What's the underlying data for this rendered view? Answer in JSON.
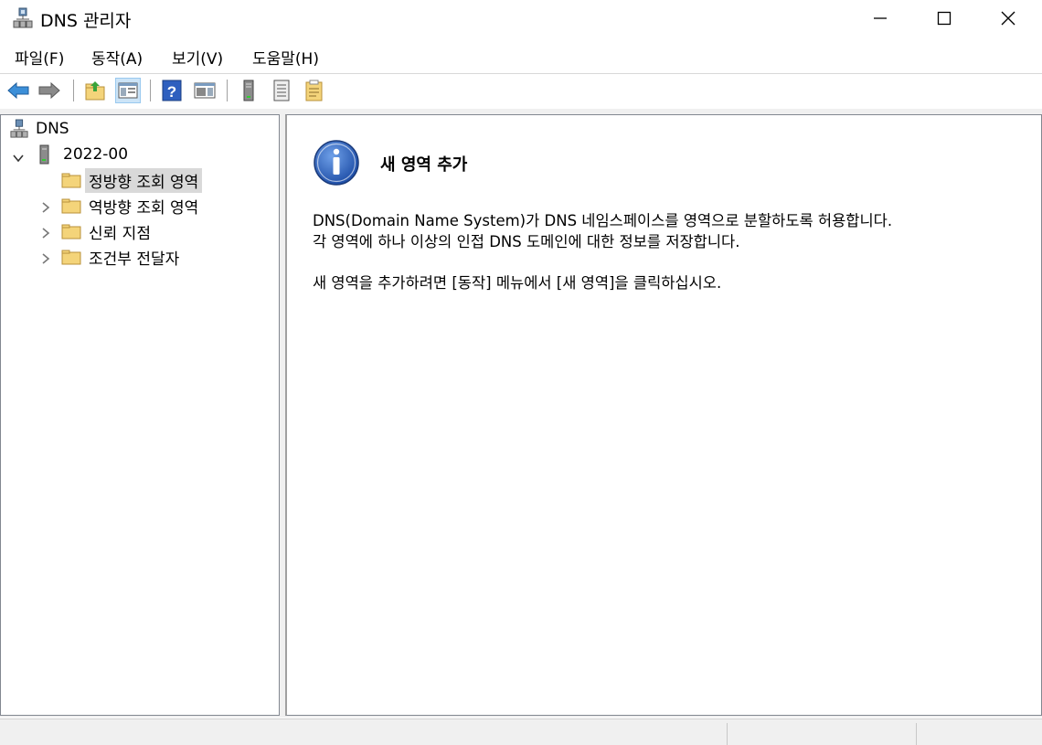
{
  "window": {
    "title": "DNS 관리자"
  },
  "menu": {
    "items": [
      "파일(F)",
      "동작(A)",
      "보기(V)",
      "도움말(H)"
    ]
  },
  "toolbar": {
    "buttons": [
      "back-arrow-icon",
      "forward-arrow-icon",
      "up-folder-icon",
      "show-hide-tree-icon",
      "help-icon",
      "action-pane-icon",
      "server-icon",
      "list-icon",
      "properties-icon"
    ]
  },
  "tree": {
    "root": "DNS",
    "server": "2022-00",
    "children": [
      "정방향 조회 영역",
      "역방향 조회 영역",
      "신뢰 지점",
      "조건부 전달자"
    ],
    "selected_index": 0
  },
  "content": {
    "title": "새 영역 추가",
    "line1": "DNS(Domain Name System)가 DNS 네임스페이스를 영역으로 분할하도록 허용합니다.",
    "line2": "각 영역에 하나 이상의 인접 DNS 도메인에 대한 정보를 저장합니다.",
    "line3": "새 영역을 추가하려면 [동작] 메뉴에서 [새 영역]을 클릭하십시오."
  },
  "colors": {
    "selection": "#d9d9d9",
    "info_blue": "#1f4fa8",
    "folder": "#f4d47a"
  }
}
